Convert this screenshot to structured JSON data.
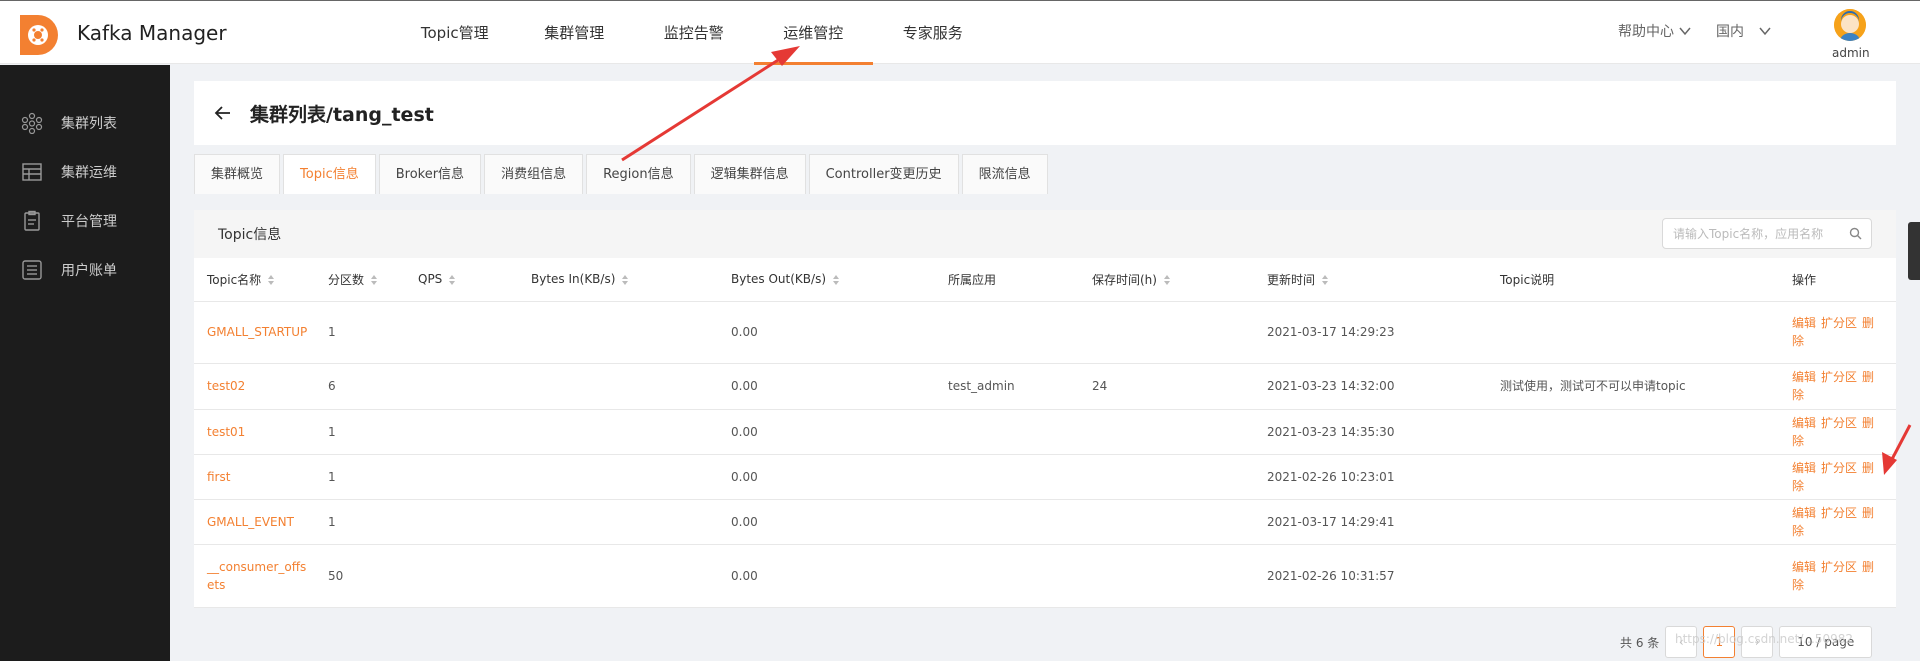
{
  "app": {
    "title": "Kafka Manager"
  },
  "nav": [
    {
      "label": "Topic管理"
    },
    {
      "label": "集群管理"
    },
    {
      "label": "监控告警"
    },
    {
      "label": "运维管控",
      "active": true
    },
    {
      "label": "专家服务"
    }
  ],
  "header_right": {
    "help": "帮助中心",
    "region": "国内",
    "user": "admin"
  },
  "sidebar": [
    {
      "label": "集群列表",
      "icon": "cluster-icon"
    },
    {
      "label": "集群运维",
      "icon": "table-icon"
    },
    {
      "label": "平台管理",
      "icon": "clipboard-icon"
    },
    {
      "label": "用户账单",
      "icon": "list-icon"
    }
  ],
  "page": {
    "title": "集群列表/tang_test"
  },
  "tabs": [
    {
      "label": "集群概览"
    },
    {
      "label": "Topic信息",
      "active": true
    },
    {
      "label": "Broker信息"
    },
    {
      "label": "消费组信息"
    },
    {
      "label": "Region信息"
    },
    {
      "label": "逻辑集群信息"
    },
    {
      "label": "Controller变更历史"
    },
    {
      "label": "限流信息"
    }
  ],
  "table": {
    "title": "Topic信息",
    "search_placeholder": "请输入Topic名称，应用名称",
    "columns": [
      "Topic名称",
      "分区数",
      "QPS",
      "Bytes In(KB/s)",
      "Bytes Out(KB/s)",
      "所属应用",
      "保存时间(h)",
      "更新时间",
      "Topic说明",
      "操作"
    ],
    "rows": [
      {
        "name": "GMALL_STARTUP",
        "partitions": "1",
        "qps": "",
        "bytes_in": "",
        "bytes_out": "0.00",
        "app": "",
        "retention": "",
        "updated": "2021-03-17 14:29:23",
        "desc": ""
      },
      {
        "name": "test02",
        "partitions": "6",
        "qps": "",
        "bytes_in": "",
        "bytes_out": "0.00",
        "app": "test_admin",
        "retention": "24",
        "updated": "2021-03-23 14:32:00",
        "desc": "测试使用，测试可不可以申请topic"
      },
      {
        "name": "test01",
        "partitions": "1",
        "qps": "",
        "bytes_in": "",
        "bytes_out": "0.00",
        "app": "",
        "retention": "",
        "updated": "2021-03-23 14:35:30",
        "desc": ""
      },
      {
        "name": "first",
        "partitions": "1",
        "qps": "",
        "bytes_in": "",
        "bytes_out": "0.00",
        "app": "",
        "retention": "",
        "updated": "2021-02-26 10:23:01",
        "desc": ""
      },
      {
        "name": "GMALL_EVENT",
        "partitions": "1",
        "qps": "",
        "bytes_in": "",
        "bytes_out": "0.00",
        "app": "",
        "retention": "",
        "updated": "2021-03-17 14:29:41",
        "desc": ""
      },
      {
        "name": "__consumer_offsets",
        "partitions": "50",
        "qps": "",
        "bytes_in": "",
        "bytes_out": "0.00",
        "app": "",
        "retention": "",
        "updated": "2021-02-26 10:31:57",
        "desc": ""
      }
    ],
    "actions": {
      "edit": "编辑",
      "expand": "扩分区",
      "delete": "删除"
    }
  },
  "pagination": {
    "total": "共 6 条",
    "prev": "‹",
    "current": "1",
    "next": "›",
    "page_size": "10 / page"
  },
  "watermark": "https://blog.csdn.net/...50982",
  "colors": {
    "accent": "#f38031",
    "sidebar_bg": "#1c1c1c",
    "annotation_arrow": "#e53935"
  }
}
